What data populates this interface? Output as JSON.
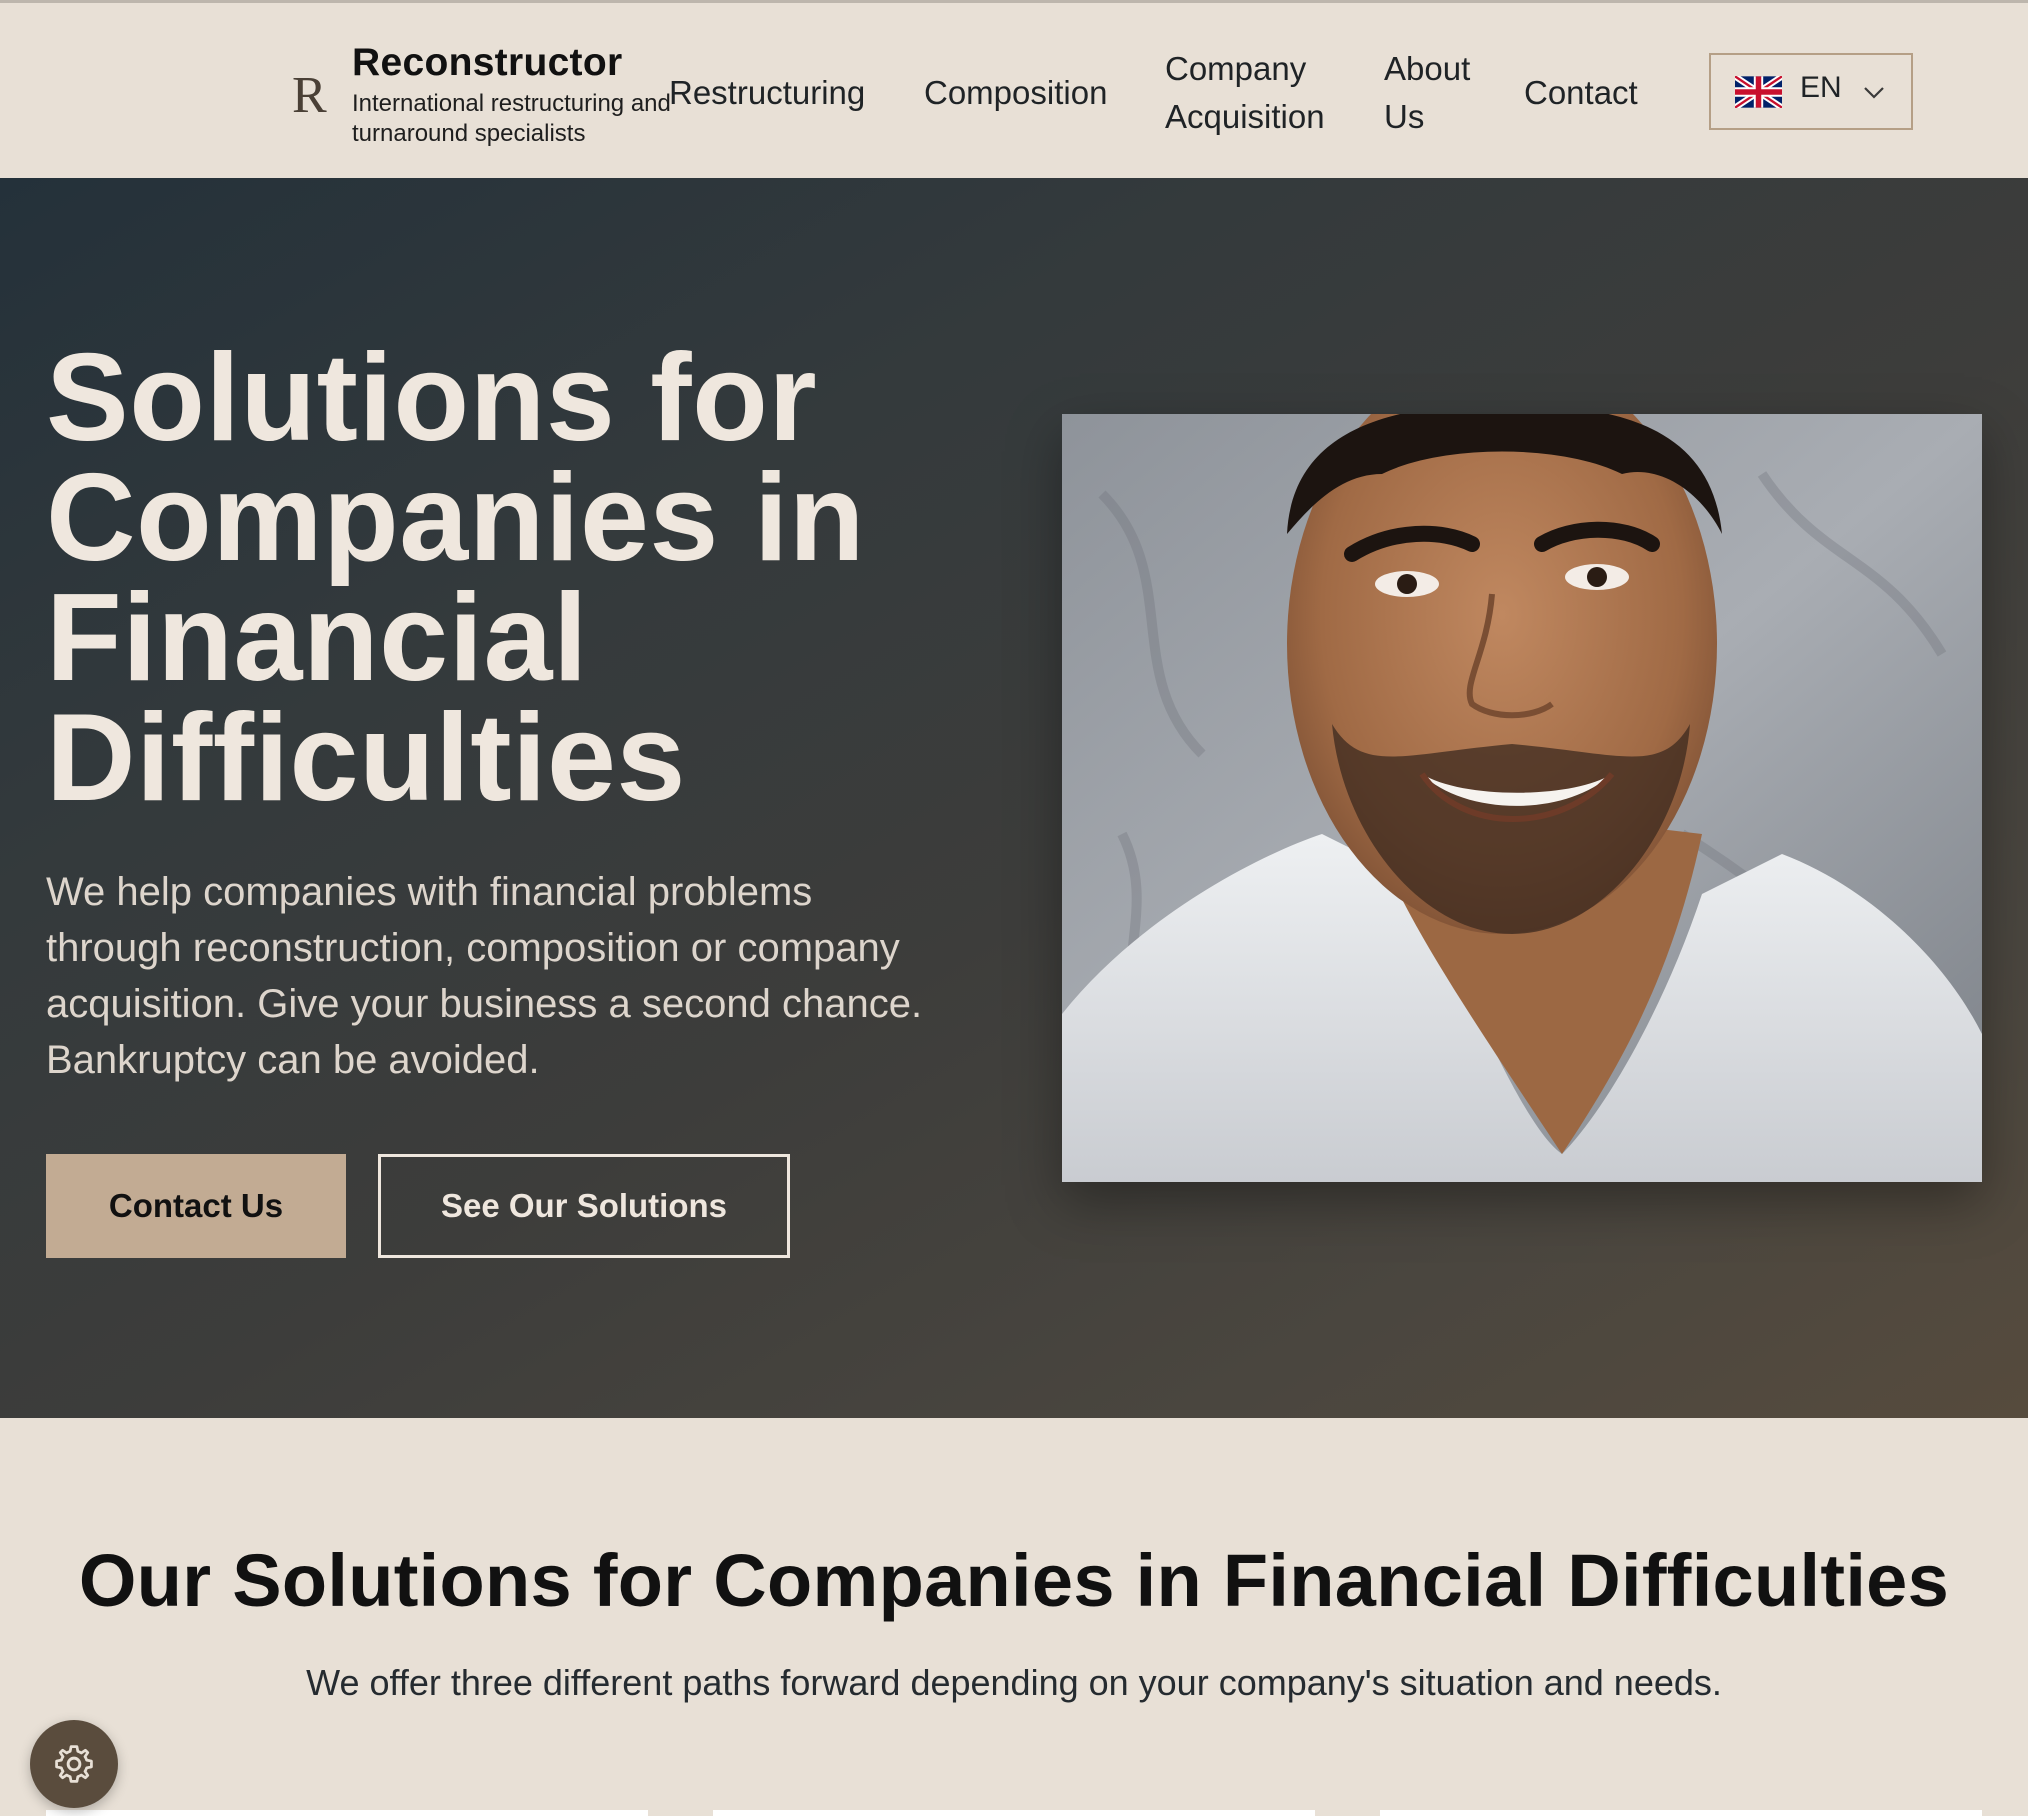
{
  "brand": {
    "mark": "R",
    "name": "Reconstructor",
    "tagline": "International restructuring and turnaround specialists"
  },
  "nav": {
    "items": [
      {
        "label": "Restructuring"
      },
      {
        "label": "Composition"
      },
      {
        "label": "Company Acquisition"
      },
      {
        "label": "About Us"
      },
      {
        "label": "Contact"
      }
    ]
  },
  "language": {
    "current": "EN",
    "flag_icon": "uk-flag-icon",
    "chevron_icon": "chevron-down-icon"
  },
  "hero": {
    "title": "Solutions for Companies in Financial Difficulties",
    "subtitle": "We help companies with financial problems through reconstruction, composition or company acquisition. Give your business a second chance. Bankruptcy can be avoided.",
    "primary_button": "Contact Us",
    "secondary_button": "See Our Solutions"
  },
  "solutions": {
    "title": "Our Solutions for Companies in Financial Difficulties",
    "subtitle": "We offer three different paths forward depending on your company's situation and needs."
  },
  "settings": {
    "icon": "gear-icon"
  },
  "colors": {
    "background": "#e8e0d6",
    "hero_dark": "#24313a",
    "hero_warm": "#564b3d",
    "accent": "#c2ab93",
    "text_light": "#efe7de"
  }
}
